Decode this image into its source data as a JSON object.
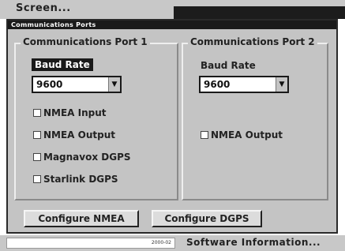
{
  "top_menu": {
    "label": "Screen..."
  },
  "dialog": {
    "title": "Communications Ports",
    "port1": {
      "legend": "Communications Port 1",
      "baud_label": "Baud Rate",
      "baud_value": "9600",
      "checks": [
        {
          "label": "NMEA Input",
          "checked": false
        },
        {
          "label": "NMEA Output",
          "checked": false
        },
        {
          "label": "Magnavox DGPS",
          "checked": false
        },
        {
          "label": "Starlink DGPS",
          "checked": false
        }
      ]
    },
    "port2": {
      "legend": "Communications Port 2",
      "baud_label": "Baud Rate",
      "baud_value": "9600",
      "checks": [
        {
          "label": "NMEA Output",
          "checked": false
        }
      ]
    },
    "buttons": {
      "configure_nmea": "Configure NMEA",
      "configure_dgps": "Configure DGPS"
    }
  },
  "bottom_menu": {
    "small_text": "2000-02",
    "software_info": "Software Information..."
  },
  "icons": {
    "dropdown": "chevron-down-icon"
  }
}
